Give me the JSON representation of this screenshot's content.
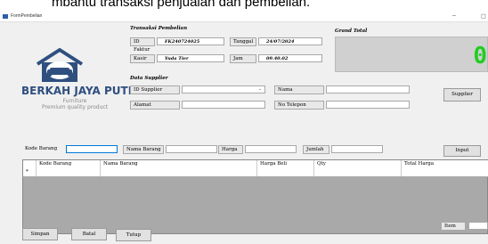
{
  "caption": "mbantu transaksi penjualan dan pembelian.",
  "window": {
    "title": "FormPembelian",
    "min_glyph": "–",
    "max_glyph": "◻"
  },
  "logo": {
    "name": "BERKAH JAYA PUTRA",
    "line1": "Furniture",
    "line2": "Premium quality product",
    "color": "#2f4f7f"
  },
  "transaksi": {
    "section_title": "Transaksi Pembelian",
    "id_faktur_label": "ID Faktur",
    "id_faktur_value": "FK240724025",
    "tanggal_label": "Tanggal",
    "tanggal_value": "24/07/2024",
    "kasir_label": "Kasir",
    "kasir_value": "Yuda Tier",
    "jam_label": "Jam",
    "jam_value": "09.40.02"
  },
  "grand_total": {
    "label": "Grand Total",
    "value": "0",
    "color": "#22cc22"
  },
  "supplier": {
    "section_title": "Data Supplier",
    "id_label": "ID Supplier",
    "nama_label": "Nama",
    "alamat_label": "Alamat",
    "telepon_label": "No Telepon",
    "button": "Supplier"
  },
  "item_entry": {
    "kode_label": "Kode Barang",
    "nama_label": "Nama Barang",
    "harga_label": "Harga",
    "jumlah_label": "Jumlah",
    "input_button": "Input"
  },
  "grid": {
    "columns": [
      "Kode Barang",
      "Nama Barang",
      "Harga Beli",
      "Qty",
      "Total Harga"
    ],
    "new_row_marker": "*"
  },
  "footer": {
    "item_label": "Item",
    "simpan": "Simpan",
    "batal": "Batal",
    "tutup": "Tutup"
  }
}
